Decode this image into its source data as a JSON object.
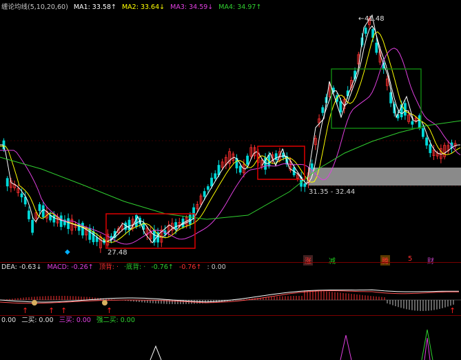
{
  "indicator_bar": {
    "name": "缠论均线(5,10,20,60)",
    "ma1": "MA1: 33.58↑",
    "ma2": "MA2: 33.64↓",
    "ma3": "MA3: 34.59↓",
    "ma4": "MA4: 34.97↑"
  },
  "price_labels": {
    "high": "41.48",
    "low": "27.48",
    "range": "31.35 - 32.44"
  },
  "event_tags": [
    "涨",
    "减",
    "腾",
    "5",
    "财"
  ],
  "macd_bar": {
    "dea": "DEA: -0.63↓",
    "macd": "MACD: -0.26↑",
    "top_div": "顶背: ·",
    "bottom_div": "·底背: ·",
    "v1": "-0.76↑",
    "v2": "-0.76↑",
    "v3": ": 0.00"
  },
  "buy_bar": {
    "v0": "0.00",
    "second_buy": "二买: 0.00",
    "third_buy": "三买: 0.00",
    "strong_second_buy": "强二买: 0.00"
  },
  "colors": {
    "up": "#ff3030",
    "down": "#00d8d8",
    "ma1": "#ffffff",
    "ma2": "#ffff00",
    "ma3": "#e040e0",
    "ma4": "#30d030",
    "box_red": "#e00000",
    "box_green": "#108010"
  }
}
